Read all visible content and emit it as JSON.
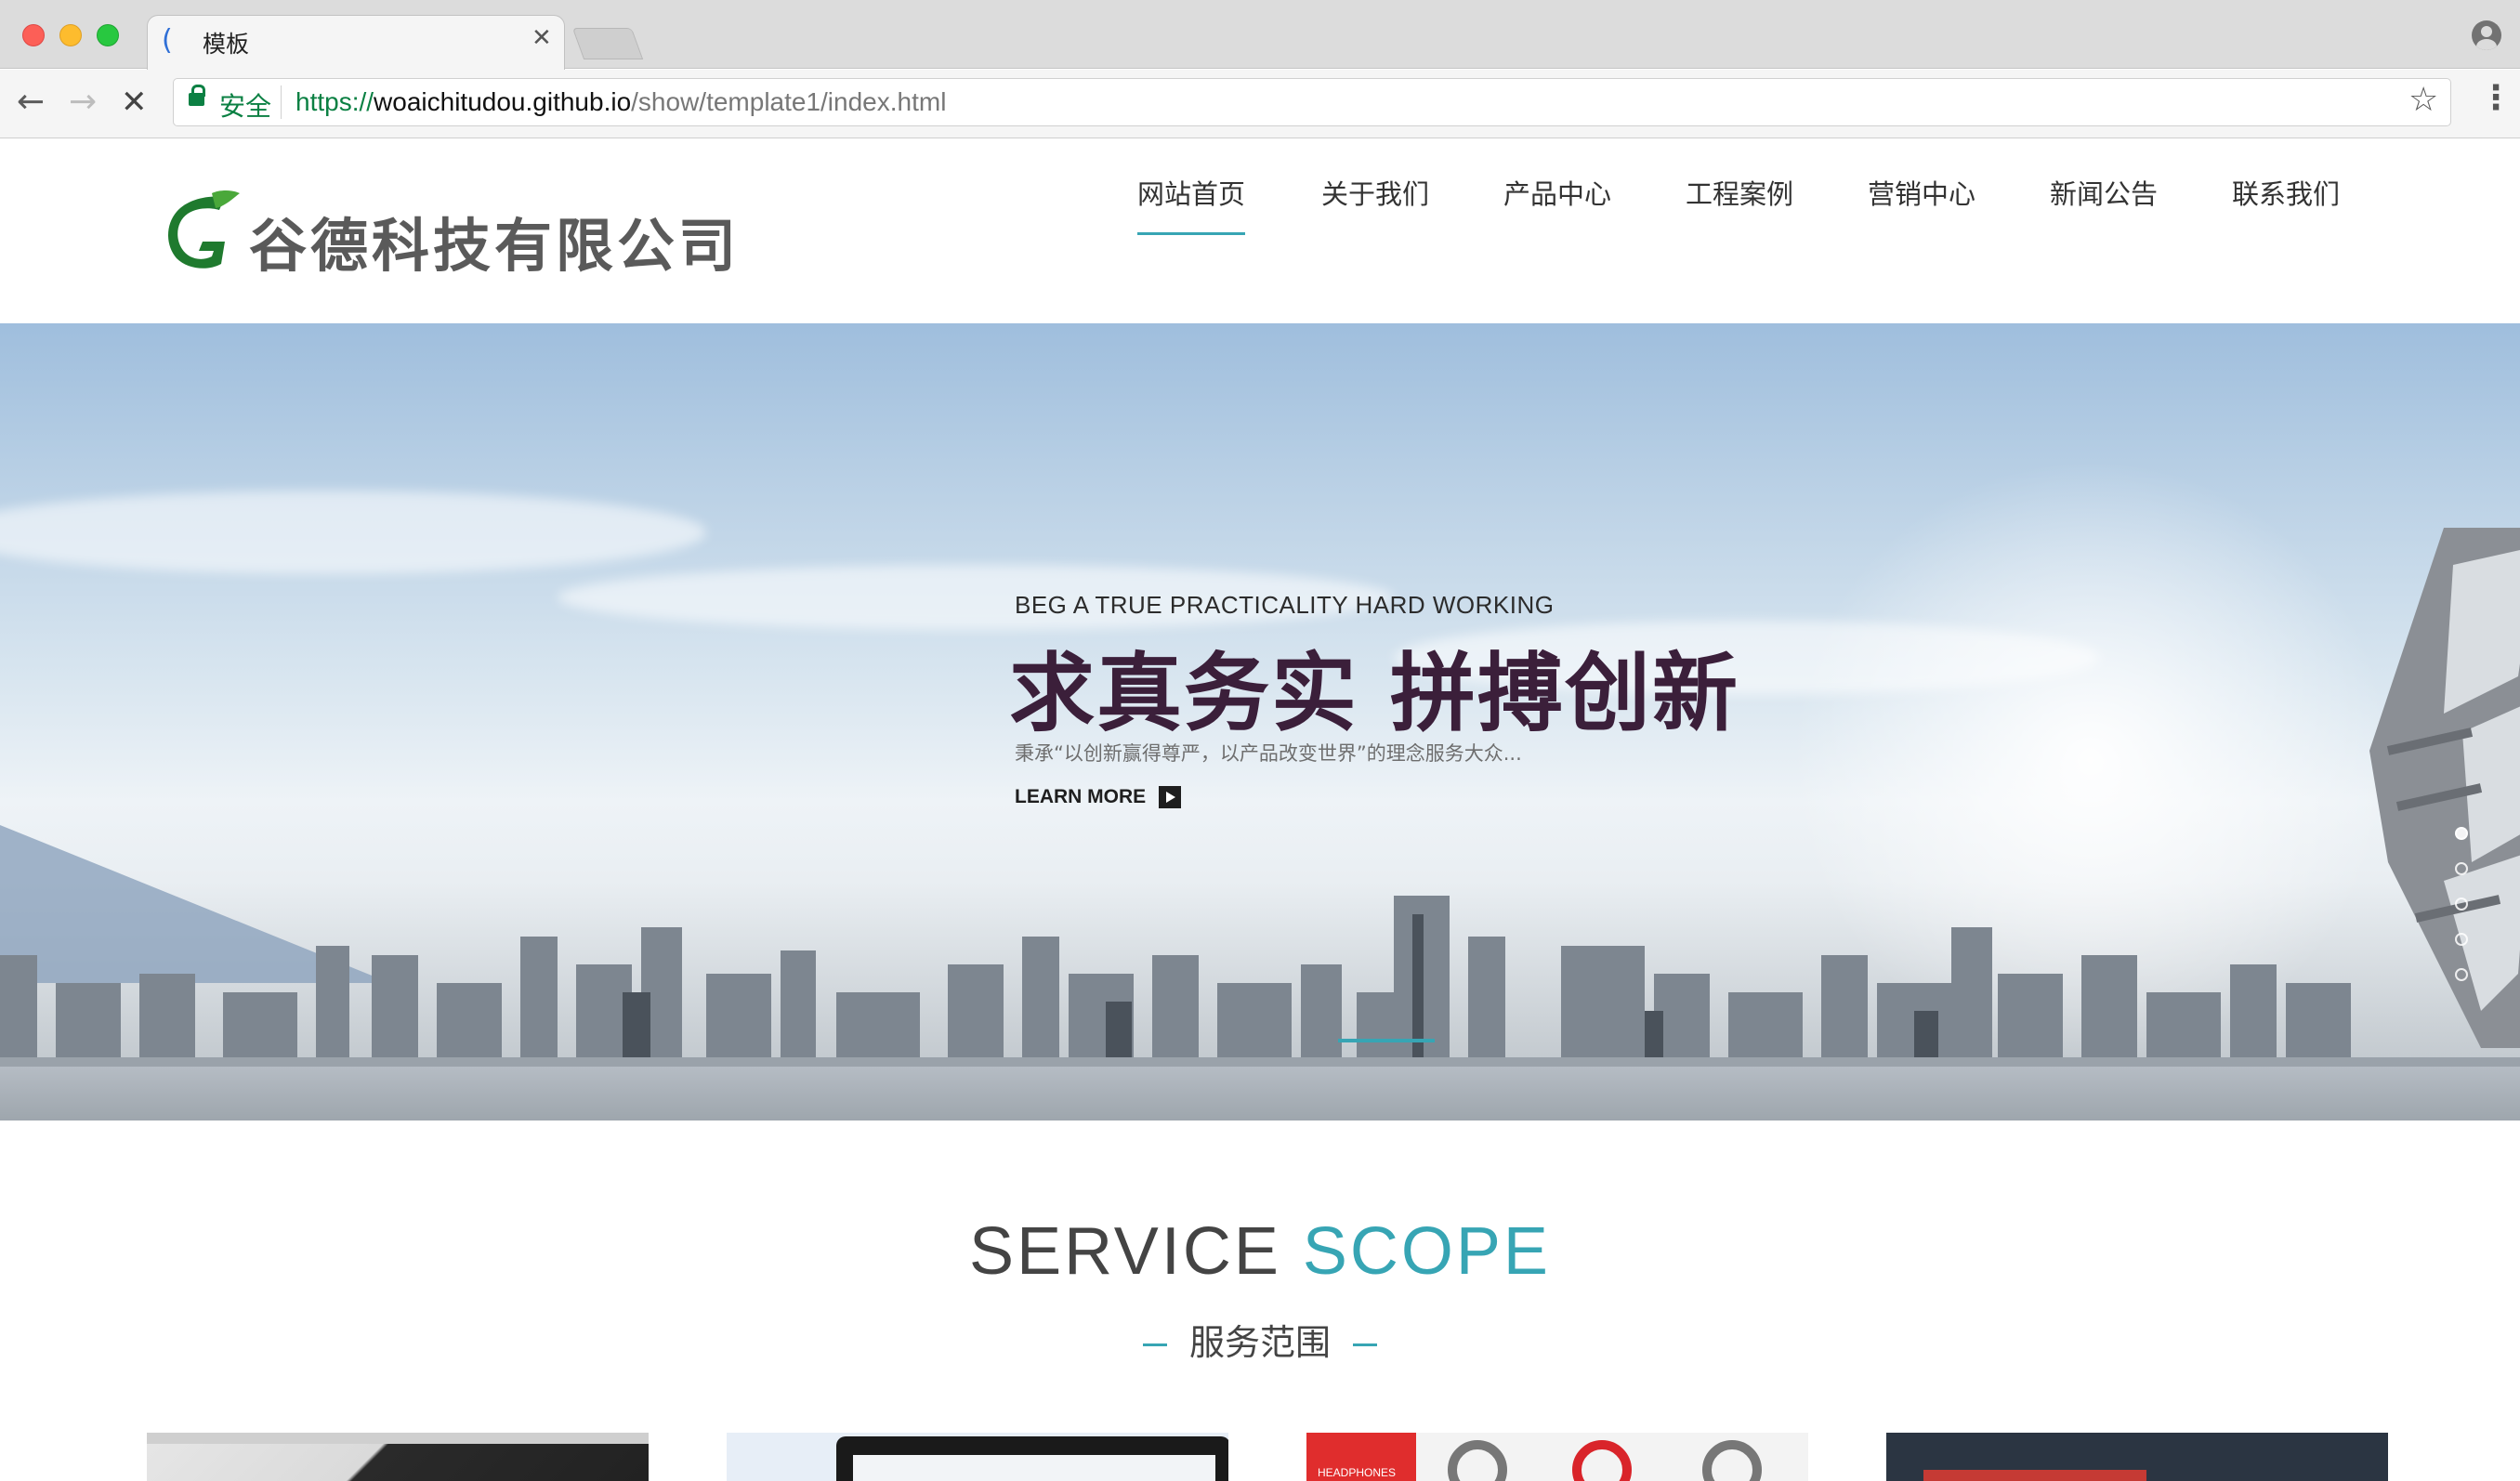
{
  "browser": {
    "tab_title": "模板",
    "security_label": "安全",
    "url_scheme": "https://",
    "url_host": "woaichitudou.github.io",
    "url_path": "/show/template1/index.html"
  },
  "header": {
    "logo_text": "谷德科技有限公司",
    "nav": [
      {
        "label": "网站首页",
        "active": true
      },
      {
        "label": "关于我们"
      },
      {
        "label": "产品中心"
      },
      {
        "label": "工程案例"
      },
      {
        "label": "营销中心"
      },
      {
        "label": "新闻公告"
      },
      {
        "label": "联系我们"
      }
    ]
  },
  "hero": {
    "subtitle_en": "BEG A TRUE PRACTICALITY HARD WORKING",
    "headline": "求真务实  拼搏创新",
    "description": "秉承“以创新赢得尊严，以产品改变世界”的理念服务大众...",
    "cta_label": "LEARN MORE",
    "slide_count": 5,
    "active_slide": 1
  },
  "services": {
    "title_part1": "SERVICE",
    "title_part2": "SCOPE",
    "subtitle": "服务范围",
    "card3_label": "HEADPHONES"
  },
  "colors": {
    "accent": "#37a5b4",
    "headline": "#3b1f3a",
    "logo_green": "#1f7a2e"
  }
}
